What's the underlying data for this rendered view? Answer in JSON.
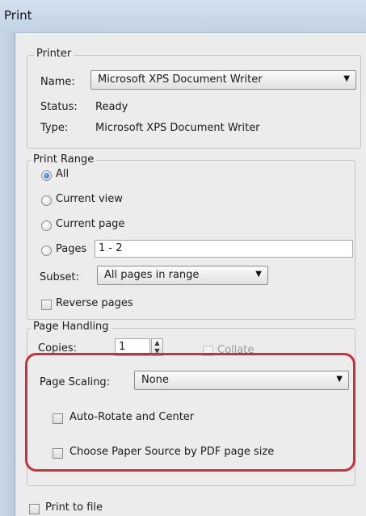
{
  "window": {
    "title": "Print"
  },
  "printer": {
    "legend": "Printer",
    "name_label": "Name:",
    "name_value": "Microsoft XPS Document Writer",
    "status_label": "Status:",
    "status_value": "Ready",
    "type_label": "Type:",
    "type_value": "Microsoft XPS Document Writer"
  },
  "print_range": {
    "legend": "Print Range",
    "all": "All",
    "current_view": "Current view",
    "current_page": "Current page",
    "pages": "Pages",
    "pages_value": "1 - 2",
    "subset_label": "Subset:",
    "subset_value": "All pages in range",
    "reverse_pages": "Reverse pages"
  },
  "page_handling": {
    "legend": "Page Handling",
    "copies_label": "Copies:",
    "copies_value": "1",
    "collate": "Collate",
    "scaling_label": "Page Scaling:",
    "scaling_value": "None",
    "auto_rotate": "Auto-Rotate and Center",
    "paper_source": "Choose Paper Source by PDF page size"
  },
  "print_to_file": "Print to file",
  "icons": {
    "dropdown": "chevron-down-icon",
    "spin": "spinner-arrows-icon"
  },
  "colors": {
    "highlight": "#c8323a",
    "radio_selected": "#1c5fb8"
  }
}
